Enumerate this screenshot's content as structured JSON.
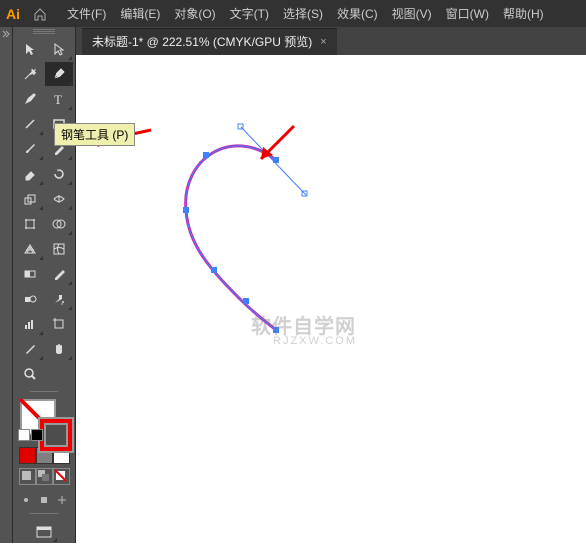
{
  "logo": "Ai",
  "menus": [
    "文件(F)",
    "编辑(E)",
    "对象(O)",
    "文字(T)",
    "选择(S)",
    "效果(C)",
    "视图(V)",
    "窗口(W)",
    "帮助(H)"
  ],
  "tab": {
    "label": "未标题-1* @ 222.51% (CMYK/GPU 预览)",
    "close": "×"
  },
  "tooltip": "钢笔工具 (P)",
  "swatches": [
    "#e00000",
    "#808080",
    "#ffffff"
  ],
  "mode_swatches": {
    "none": "#ffffff",
    "grad": "#e00",
    "none2": "#fff"
  }
}
